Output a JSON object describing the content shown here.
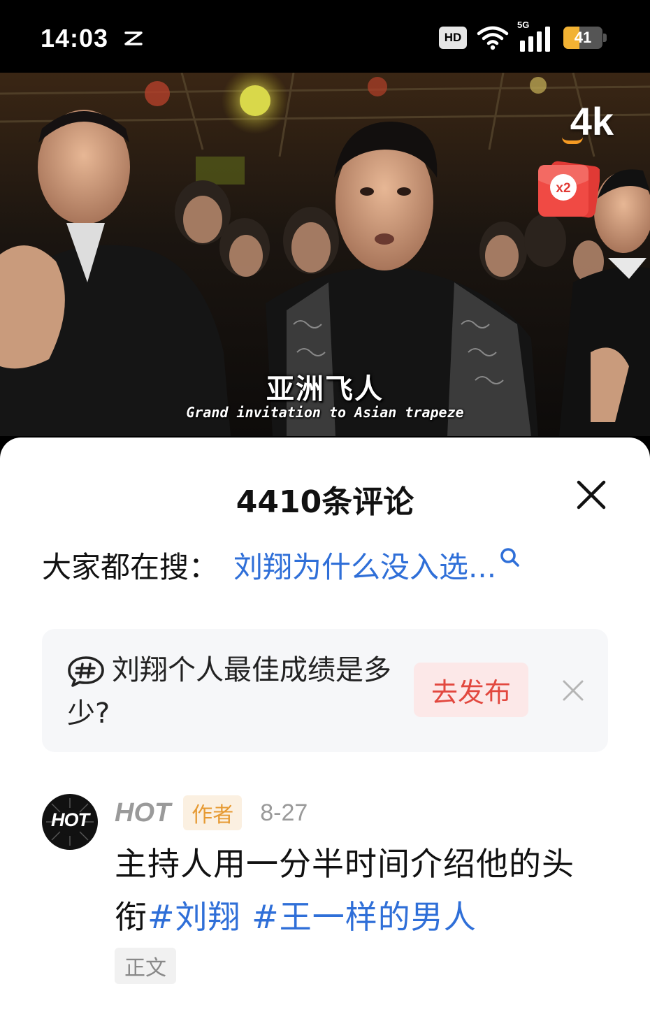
{
  "status_bar": {
    "time": "14:03",
    "hd_label": "HD",
    "network_label": "5G",
    "battery_level": "41",
    "battery_percent": 41,
    "battery_color": "#f2b233"
  },
  "video": {
    "quality_label": "4k",
    "redpacket_label": "x2",
    "subtitle_cn": "亚洲飞人",
    "subtitle_en": "Grand invitation to Asian trapeze"
  },
  "comments_panel": {
    "title": "4410条评论",
    "close_icon": "close-icon",
    "search_suggestion": {
      "prefix": "大家都在搜：",
      "query": "刘翔为什么没入选...",
      "icon": "search-icon"
    },
    "topic_prompt": {
      "icon": "hashtag-bubble-icon",
      "text": "刘翔个人最佳成绩是多少?",
      "publish_label": "去发布",
      "dismiss_icon": "close-icon"
    },
    "comments": [
      {
        "avatar_text": "HOT",
        "author": "HOT",
        "badge": "作者",
        "date": "8-27",
        "body_text": "主持人用一分半时间介绍他的头衔",
        "hashtags": [
          "#刘翔",
          "#王一样的男人"
        ],
        "tag": "正文"
      }
    ]
  },
  "colors": {
    "link_blue": "#2f6fd8",
    "publish_red": "#e2483f",
    "author_badge_orange": "#e69a33"
  }
}
